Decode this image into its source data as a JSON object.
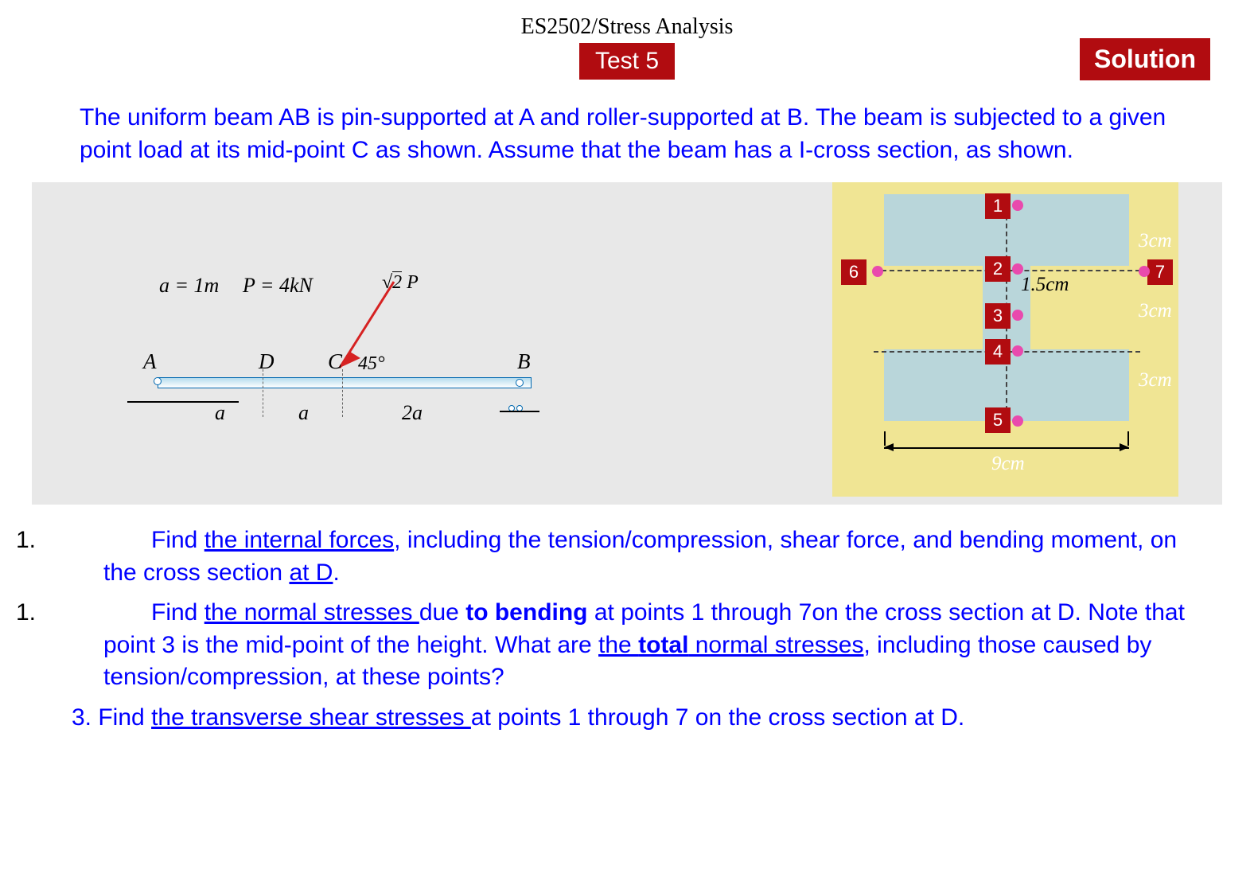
{
  "header": {
    "course": "ES2502/Stress Analysis",
    "test": "Test  5",
    "solution": "Solution"
  },
  "problem": "The uniform beam AB is pin-supported at A and roller-supported at B.  The beam is subjected to a given point load at its mid-point C as shown.  Assume that the beam has a I-cross section, as shown.",
  "beam": {
    "a_eq": "a = 1m",
    "P_eq": "P = 4kN",
    "root2P": "√2 P",
    "angle": "45°",
    "A": "A",
    "B": "B",
    "C": "C",
    "D": "D",
    "dim_a1": "a",
    "dim_a2": "a",
    "dim_2a": "2a"
  },
  "xs": {
    "n1": "1",
    "n2": "2",
    "n3": "3",
    "n4": "4",
    "n5": "5",
    "n6": "6",
    "n7": "7",
    "d15": "1.5cm",
    "d3a": "3cm",
    "d3b": "3cm",
    "d3c": "3cm",
    "d9": "9cm"
  },
  "q": {
    "num1a": "1.",
    "num1b": "1.",
    "lead_find": "Find  ",
    "q1_ul": "the internal forces",
    "q1_rest": ", including the tension/compression, shear force, and bending moment, on the cross section ",
    "q1_atD": "at D",
    "q1_dot": ".",
    "q2_ul": "the normal stresses ",
    "q2_mid1": "due ",
    "q2_bold": "to bending",
    "q2_mid2": " at points 1 through 7on the cross section at D. Note that point 3 is the mid-point of the height. What are ",
    "q2_ul2a": "the ",
    "q2_total": "total",
    "q2_ul2b": " normal stresses",
    "q2_rest": ", including those caused by tension/compression,  at these points?",
    "q3_lead": "3. Find ",
    "q3_ul": "the transverse shear stresses ",
    "q3_rest": "at points 1 through 7 on the cross section at D."
  }
}
